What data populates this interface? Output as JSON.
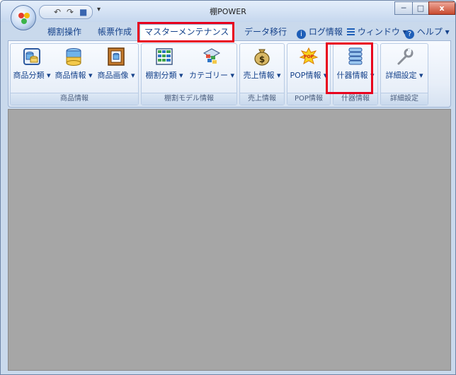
{
  "window": {
    "title": "棚POWER",
    "qat": {
      "undo": "↶",
      "redo": "↷",
      "save": "■",
      "dropdown": "▾"
    },
    "controls": {
      "minimize": "─",
      "maximize": "□",
      "close": "x"
    }
  },
  "tabs": [
    {
      "label": "棚割操作"
    },
    {
      "label": "帳票作成"
    },
    {
      "label": "マスターメンテナンス"
    },
    {
      "label": "データ移行"
    }
  ],
  "right_menu": {
    "log": "ログ情報",
    "window": "ウィンドウ ▾",
    "help": "ヘルプ ▾"
  },
  "ribbon": {
    "groups": [
      {
        "label": "商品情報"
      },
      {
        "label": "棚割モデル情報"
      },
      {
        "label": "売上情報"
      },
      {
        "label": "POP情報"
      },
      {
        "label": "什器情報"
      },
      {
        "label": "詳細設定"
      }
    ],
    "buttons": [
      {
        "label": "商品分類 ▾"
      },
      {
        "label": "商品情報 ▾"
      },
      {
        "label": "商品画像 ▾"
      },
      {
        "label": "棚割分類 ▾"
      },
      {
        "label": "カテゴリー ▾"
      },
      {
        "label": "売上情報 ▾"
      },
      {
        "label": "POP情報 ▾"
      },
      {
        "label": "什器情報 ▾"
      },
      {
        "label": "詳細設定 ▾"
      }
    ],
    "pop_badge": "POP"
  },
  "colors": {
    "highlight": "#e8001d",
    "workspace": "#a6a6a6",
    "text": "#15428b"
  }
}
